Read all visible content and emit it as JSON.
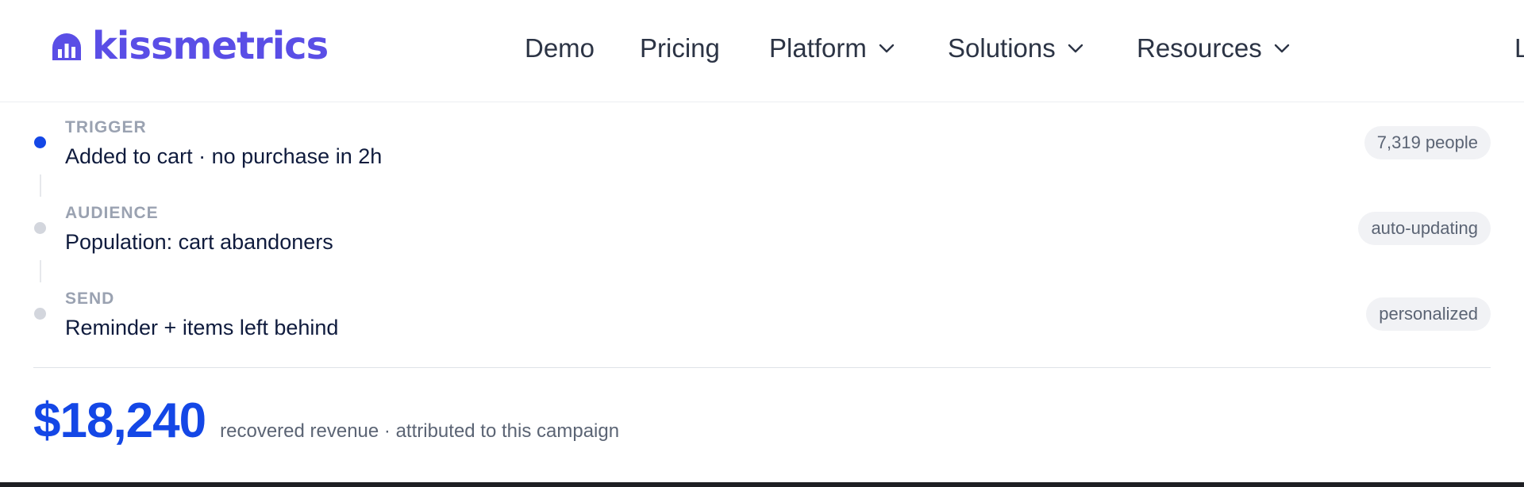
{
  "nav": {
    "logo_text": "kissmetrics",
    "items": [
      {
        "label": "Demo",
        "has_dropdown": false
      },
      {
        "label": "Pricing",
        "has_dropdown": false
      },
      {
        "label": "Platform",
        "has_dropdown": true
      },
      {
        "label": "Solutions",
        "has_dropdown": true
      },
      {
        "label": "Resources",
        "has_dropdown": true
      }
    ],
    "cutoff_item": "L"
  },
  "flow": {
    "steps": [
      {
        "kicker": "TRIGGER",
        "title": "Added to cart · no purchase in 2h",
        "pill": "7,319 people",
        "active": true
      },
      {
        "kicker": "AUDIENCE",
        "title": "Population: cart abandoners",
        "pill": "auto-updating",
        "active": false
      },
      {
        "kicker": "SEND",
        "title": "Reminder + items left behind",
        "pill": "personalized",
        "active": false
      }
    ]
  },
  "summary": {
    "value": "$18,240",
    "caption": "recovered revenue · attributed to this campaign"
  },
  "colors": {
    "brand": "#5a4ee6",
    "accent": "#1447e6",
    "active_dot": "#1447e6",
    "inactive_dot": "#d3d6dd"
  }
}
